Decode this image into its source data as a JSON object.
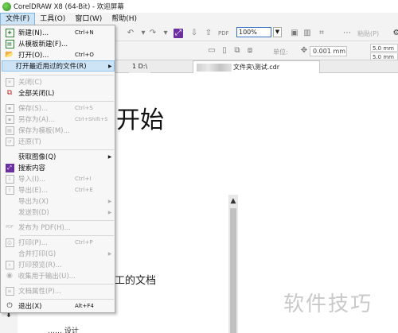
{
  "window": {
    "title": "CorelDRAW X8 (64-Bit) - 欢迎屏幕"
  },
  "menubar": {
    "items": [
      {
        "label": "文件(F)",
        "active": true
      },
      {
        "label": "工具(O)",
        "active": false
      },
      {
        "label": "窗口(W)",
        "active": false
      },
      {
        "label": "帮助(H)",
        "active": false
      }
    ]
  },
  "toolbar": {
    "zoom_value": "100%",
    "paste_label": "粘贴(P)",
    "unit_label": "单位:",
    "nudge_value": "0.001 mm",
    "dup_x": "5.0 mm",
    "dup_y": "5.0 mm"
  },
  "tabs": {
    "recent_label": "1 D:\\",
    "doc_label": "文件夹\\测试.cdr"
  },
  "file_menu": {
    "items": [
      {
        "label": "新建(N)...",
        "shortcut": "Ctrl+N",
        "enabled": true,
        "icon": "new-document-icon"
      },
      {
        "label": "从模板新建(F)...",
        "shortcut": "",
        "enabled": true,
        "icon": "new-from-template-icon"
      },
      {
        "label": "打开(O)...",
        "shortcut": "Ctrl+O",
        "enabled": true,
        "icon": "open-folder-icon"
      },
      {
        "label": "打开最近用过的文件(R)",
        "shortcut": "",
        "enabled": true,
        "submenu": true,
        "highlighted": true
      },
      {
        "label": "关闭(C)",
        "shortcut": "",
        "enabled": false,
        "icon": "close-document-icon"
      },
      {
        "label": "全部关闭(L)",
        "shortcut": "",
        "enabled": true,
        "icon": "close-all-icon"
      },
      {
        "label": "保存(S)...",
        "shortcut": "Ctrl+S",
        "enabled": false,
        "icon": "save-icon"
      },
      {
        "label": "另存为(A)...",
        "shortcut": "Ctrl+Shift+S",
        "enabled": false,
        "icon": "save-as-icon"
      },
      {
        "label": "保存为模板(M)...",
        "shortcut": "",
        "enabled": false,
        "icon": "save-template-icon"
      },
      {
        "label": "还原(T)",
        "shortcut": "",
        "enabled": false,
        "icon": "revert-icon"
      },
      {
        "label": "获取图像(Q)",
        "shortcut": "",
        "enabled": true,
        "submenu": true
      },
      {
        "label": "搜索内容",
        "shortcut": "",
        "enabled": true,
        "icon": "search-content-icon"
      },
      {
        "label": "导入(I)...",
        "shortcut": "Ctrl+I",
        "enabled": false,
        "icon": "import-icon"
      },
      {
        "label": "导出(E)...",
        "shortcut": "Ctrl+E",
        "enabled": false,
        "icon": "export-icon"
      },
      {
        "label": "导出为(X)",
        "shortcut": "",
        "enabled": false,
        "submenu": true
      },
      {
        "label": "发送到(D)",
        "shortcut": "",
        "enabled": false,
        "submenu": true
      },
      {
        "label": "发布为 PDF(H)...",
        "shortcut": "",
        "enabled": false,
        "icon": "pdf-icon"
      },
      {
        "label": "打印(P)...",
        "shortcut": "Ctrl+P",
        "enabled": false,
        "icon": "print-icon"
      },
      {
        "label": "合并打印(G)",
        "shortcut": "",
        "enabled": false,
        "submenu": true
      },
      {
        "label": "打印预览(R)...",
        "shortcut": "",
        "enabled": false,
        "icon": "print-preview-icon"
      },
      {
        "label": "收集用于输出(U)...",
        "shortcut": "",
        "enabled": false,
        "icon": "collect-output-icon"
      },
      {
        "label": "文档属性(P)...",
        "shortcut": "",
        "enabled": false,
        "icon": "document-properties-icon"
      },
      {
        "label": "退出(X)",
        "shortcut": "Alt+F4",
        "enabled": true,
        "icon": "exit-icon"
      }
    ]
  },
  "welcome": {
    "title": "开始",
    "doc_text": "工的文档",
    "small_text": "…… 设计"
  },
  "watermark": "软件技巧",
  "colors": {
    "menu_highlight": "#cde4f7",
    "zoom_border": "#3a73c4",
    "search_icon": "#6b2fa0"
  }
}
